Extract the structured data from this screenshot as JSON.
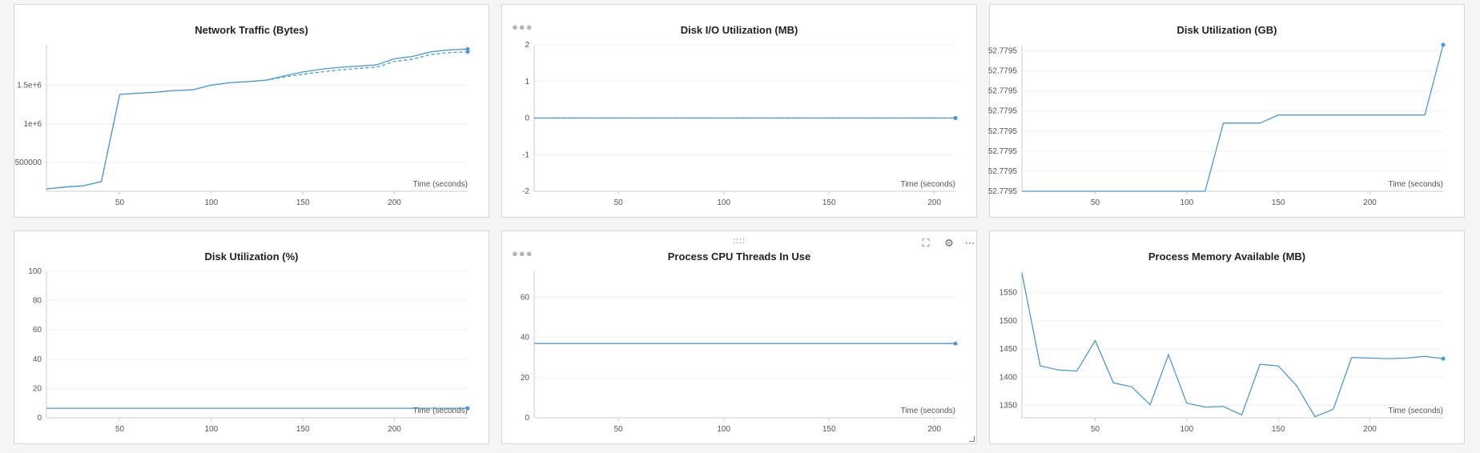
{
  "colors": {
    "series": "#4a9ad8",
    "axis": "#cccccc",
    "grid": "#f0f0f0",
    "text": "#555555",
    "panel_bg": "#ffffff",
    "page_bg": "#f5f5f5"
  },
  "panel_controls": {
    "drag_handle": "::::",
    "menu_icon": "three-dots-icon",
    "expand_icon": "expand-icon",
    "settings_icon": "gear-icon",
    "more_icon": "more-horizontal-icon"
  },
  "chart_data": [
    {
      "id": "network",
      "title": "Network Traffic (Bytes)",
      "type": "line",
      "xlabel": "Time (seconds)",
      "xticks": [
        50,
        100,
        150,
        200
      ],
      "xlim": [
        10,
        240
      ],
      "yticks": [
        500000,
        1000000,
        1500000
      ],
      "ytick_labels": [
        "500000",
        "1e+6",
        "1.5e+6"
      ],
      "ylim": [
        130000,
        2020000
      ],
      "grid": true,
      "show_menu_dots": false,
      "series": [
        {
          "style": "solid",
          "points": [
            [
              10,
              160000
            ],
            [
              20,
              185000
            ],
            [
              30,
              200000
            ],
            [
              40,
              255000
            ],
            [
              50,
              1380000
            ],
            [
              60,
              1395000
            ],
            [
              70,
              1410000
            ],
            [
              80,
              1430000
            ],
            [
              90,
              1440000
            ],
            [
              100,
              1500000
            ],
            [
              110,
              1530000
            ],
            [
              120,
              1545000
            ],
            [
              130,
              1565000
            ],
            [
              140,
              1620000
            ],
            [
              150,
              1670000
            ],
            [
              160,
              1705000
            ],
            [
              170,
              1730000
            ],
            [
              180,
              1745000
            ],
            [
              190,
              1760000
            ],
            [
              200,
              1840000
            ],
            [
              210,
              1870000
            ],
            [
              220,
              1930000
            ],
            [
              230,
              1955000
            ],
            [
              240,
              1965000
            ]
          ]
        },
        {
          "style": "dashed",
          "points": [
            [
              10,
              160000
            ],
            [
              20,
              185000
            ],
            [
              30,
              200000
            ],
            [
              40,
              255000
            ],
            [
              50,
              1380000
            ],
            [
              60,
              1395000
            ],
            [
              70,
              1410000
            ],
            [
              80,
              1430000
            ],
            [
              90,
              1440000
            ],
            [
              100,
              1500000
            ],
            [
              110,
              1530000
            ],
            [
              120,
              1545000
            ],
            [
              130,
              1565000
            ],
            [
              140,
              1605000
            ],
            [
              150,
              1640000
            ],
            [
              160,
              1670000
            ],
            [
              170,
              1695000
            ],
            [
              180,
              1715000
            ],
            [
              190,
              1730000
            ],
            [
              200,
              1805000
            ],
            [
              210,
              1835000
            ],
            [
              220,
              1895000
            ],
            [
              230,
              1920000
            ],
            [
              240,
              1930000
            ]
          ]
        }
      ]
    },
    {
      "id": "diskio",
      "title": "Disk I/O Utilization (MB)",
      "type": "line",
      "xlabel": "Time (seconds)",
      "xticks": [
        50,
        100,
        150,
        200
      ],
      "xlim": [
        10,
        210
      ],
      "yticks": [
        -2,
        -1,
        0,
        1,
        2
      ],
      "ytick_labels": [
        "-2",
        "-1",
        "0",
        "1",
        "2"
      ],
      "ylim": [
        -2,
        2
      ],
      "grid": true,
      "show_menu_dots": true,
      "series": [
        {
          "style": "solid",
          "points": [
            [
              10,
              0
            ],
            [
              210,
              0
            ]
          ]
        },
        {
          "style": "dashed",
          "points": [
            [
              10,
              0
            ],
            [
              210,
              0
            ]
          ]
        }
      ]
    },
    {
      "id": "diskgb",
      "title": "Disk Utilization (GB)",
      "type": "line",
      "xlabel": "Time (seconds)",
      "xticks": [
        50,
        100,
        150,
        200
      ],
      "xlim": [
        10,
        240
      ],
      "yticks": [
        0,
        1,
        2,
        3,
        4,
        5,
        6,
        7
      ],
      "ytick_labels": [
        "52.7795",
        "52.7795",
        "52.7795",
        "52.7795",
        "52.7795",
        "52.7795",
        "52.7795",
        "52.7795"
      ],
      "ylim": [
        0,
        7.3
      ],
      "grid": true,
      "show_menu_dots": false,
      "series": [
        {
          "style": "solid",
          "points": [
            [
              10,
              0
            ],
            [
              110,
              0
            ],
            [
              120,
              3.4
            ],
            [
              140,
              3.4
            ],
            [
              150,
              3.8
            ],
            [
              230,
              3.8
            ],
            [
              240,
              7.3
            ]
          ]
        }
      ]
    },
    {
      "id": "diskpct",
      "title": "Disk Utilization (%)",
      "type": "line",
      "xlabel": "Time (seconds)",
      "xticks": [
        50,
        100,
        150,
        200
      ],
      "xlim": [
        10,
        240
      ],
      "yticks": [
        0,
        20,
        40,
        60,
        80,
        100
      ],
      "ytick_labels": [
        "0",
        "20",
        "40",
        "60",
        "80",
        "100"
      ],
      "ylim": [
        0,
        100
      ],
      "grid": true,
      "show_menu_dots": false,
      "series": [
        {
          "style": "solid",
          "points": [
            [
              10,
              6.5
            ],
            [
              240,
              6.5
            ]
          ]
        }
      ]
    },
    {
      "id": "threads",
      "title": "Process CPU Threads In Use",
      "type": "line",
      "xlabel": "Time (seconds)",
      "xticks": [
        50,
        100,
        150,
        200
      ],
      "xlim": [
        10,
        210
      ],
      "yticks": [
        0,
        20,
        40,
        60
      ],
      "ytick_labels": [
        "0",
        "20",
        "40",
        "60"
      ],
      "ylim": [
        0,
        73
      ],
      "grid": true,
      "show_menu_dots": true,
      "series": [
        {
          "style": "solid",
          "points": [
            [
              10,
              37
            ],
            [
              210,
              37
            ]
          ]
        }
      ]
    },
    {
      "id": "memory",
      "title": "Process Memory Available (MB)",
      "type": "line",
      "xlabel": "Time (seconds)",
      "xticks": [
        50,
        100,
        150,
        200
      ],
      "xlim": [
        10,
        240
      ],
      "yticks": [
        1350,
        1400,
        1450,
        1500,
        1550
      ],
      "ytick_labels": [
        "1350",
        "1400",
        "1450",
        "1500",
        "1550"
      ],
      "ylim": [
        1328,
        1588
      ],
      "grid": true,
      "show_menu_dots": false,
      "series": [
        {
          "style": "solid",
          "points": [
            [
              10,
              1585
            ],
            [
              20,
              1420
            ],
            [
              30,
              1413
            ],
            [
              40,
              1411
            ],
            [
              50,
              1465
            ],
            [
              60,
              1390
            ],
            [
              70,
              1383
            ],
            [
              80,
              1351
            ],
            [
              90,
              1440
            ],
            [
              100,
              1354
            ],
            [
              110,
              1347
            ],
            [
              120,
              1348
            ],
            [
              130,
              1333
            ],
            [
              140,
              1423
            ],
            [
              150,
              1420
            ],
            [
              160,
              1385
            ],
            [
              170,
              1330
            ],
            [
              180,
              1343
            ],
            [
              190,
              1435
            ],
            [
              200,
              1434
            ],
            [
              210,
              1433
            ],
            [
              220,
              1434
            ],
            [
              230,
              1437
            ],
            [
              240,
              1433
            ]
          ]
        }
      ]
    }
  ]
}
